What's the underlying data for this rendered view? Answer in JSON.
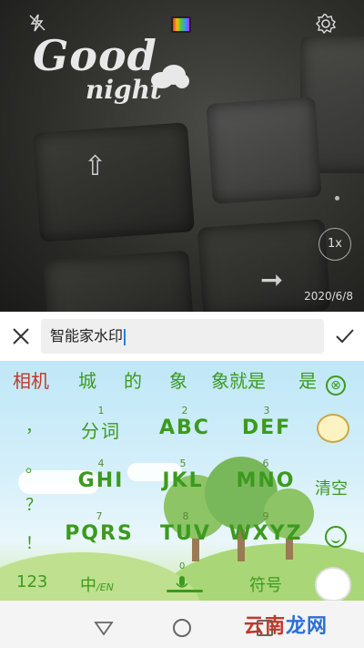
{
  "camera": {
    "watermark_line1": "Good",
    "watermark_line2": "night",
    "zoom_label": "1x",
    "date_stamp": "2020/6/8",
    "icons": [
      "flash-off-icon",
      "filter-icon",
      "gear-icon"
    ]
  },
  "input": {
    "value": "智能家水印",
    "close_icon": "close-icon",
    "confirm_icon": "check-icon"
  },
  "keyboard": {
    "candidates": [
      "相机",
      "城",
      "的",
      "象",
      "象就是",
      "是"
    ],
    "symbols": [
      "，",
      "。",
      "？",
      "！"
    ],
    "keys": [
      {
        "num": "1",
        "label": "分词"
      },
      {
        "num": "2",
        "label": "ABC"
      },
      {
        "num": "3",
        "label": "DEF"
      },
      {
        "num": "4",
        "label": "GHI"
      },
      {
        "num": "5",
        "label": "JKL"
      },
      {
        "num": "6",
        "label": "MNO"
      },
      {
        "num": "7",
        "label": "PQRS"
      },
      {
        "num": "8",
        "label": "TUV"
      },
      {
        "num": "9",
        "label": "WXYZ"
      }
    ],
    "clear_label": "清空",
    "bottom": {
      "numbers": "123",
      "lang_cn": "中",
      "lang_en": "/EN",
      "space_num": "0",
      "symbols": "符号"
    },
    "accent_color": "#3c9a1e"
  },
  "navbar": {
    "site_mark_1": "云南",
    "site_mark_2": "龙网"
  }
}
